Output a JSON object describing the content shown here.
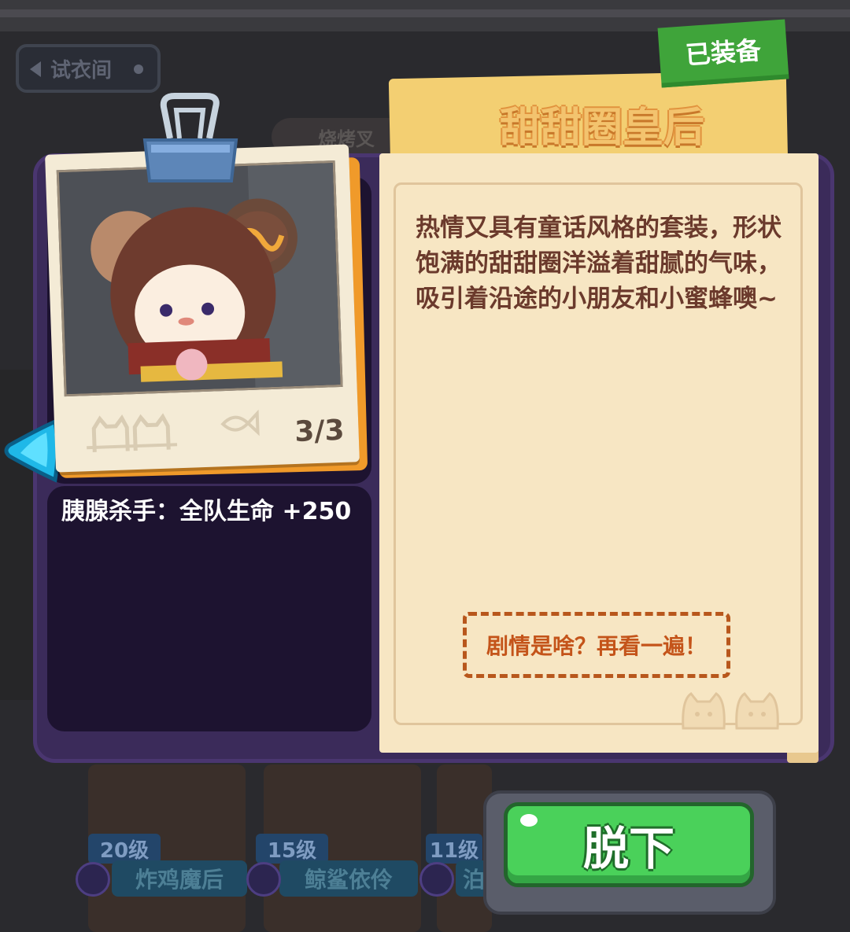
{
  "header": {
    "back_label": "试衣间"
  },
  "background": {
    "category_label": "烧烤叉"
  },
  "outfit": {
    "title": "甜甜圈皇后",
    "status_badge": "已装备",
    "count": "3/3",
    "bonus": "胰腺杀手：全队生命 +250",
    "description": "热情又具有童话风格的套装，形状饱满的甜甜圈洋溢着甜腻的气味，吸引着沿途的小朋友和小蜜蜂噢~",
    "story_button": "剧情是啥？再看一遍！"
  },
  "characters": [
    {
      "level": "20级",
      "name": "炸鸡魔后"
    },
    {
      "level": "15级",
      "name": "鲸鲨依伶"
    },
    {
      "level": "11级",
      "name": "泊"
    }
  ],
  "actions": {
    "take_off": "脱下"
  },
  "colors": {
    "panel": "#3b2b5a",
    "paper": "#f7e6c3",
    "badge_green": "#3fa43a",
    "button_green": "#4ad15a",
    "desc_text": "#6b3a2c",
    "story_text": "#c4541a"
  }
}
